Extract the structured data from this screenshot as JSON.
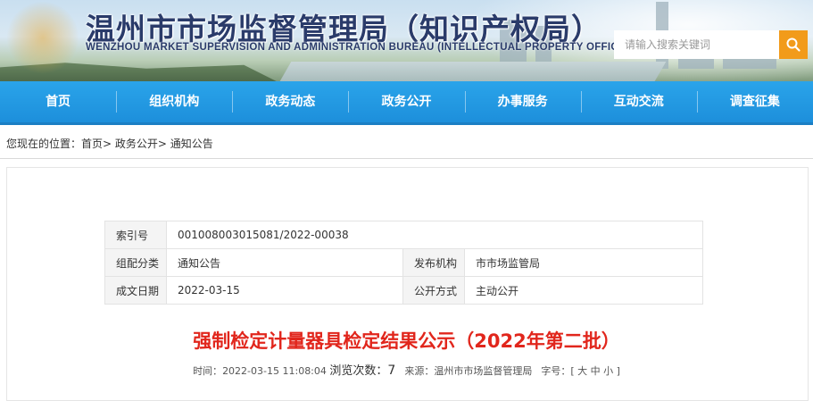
{
  "header": {
    "title_cn": "温州市市场监督管理局（知识产权局）",
    "title_en": "WENZHOU MARKET SUPERVISION AND ADMINISTRATION BUREAU (INTELLECTUAL PROPERTY OFFICE)",
    "search_placeholder": "请输入搜索关键词",
    "search_icon": "search-icon"
  },
  "nav": {
    "items": [
      "首页",
      "组织机构",
      "政务动态",
      "政务公开",
      "办事服务",
      "互动交流",
      "调查征集"
    ]
  },
  "breadcrumb": {
    "prefix": "您现在的位置：",
    "items": [
      "首页",
      "政务公开",
      "通知公告"
    ],
    "separator": "> "
  },
  "meta": {
    "index_label": "索引号",
    "index_value": "001008003015081/2022-00038",
    "category_label": "组配分类",
    "category_value": "通知公告",
    "publisher_label": "发布机构",
    "publisher_value": "市市场监管局",
    "date_label": "成文日期",
    "date_value": "2022-03-15",
    "method_label": "公开方式",
    "method_value": "主动公开"
  },
  "article": {
    "title": "强制检定计量器具检定结果公示（2022年第二批）",
    "time_label": "时间：",
    "time_value": "2022-03-15 11:08:04",
    "views_label": "浏览次数：",
    "views_value": "7",
    "source_label": "来源：",
    "source_value": "温州市市场监督管理局",
    "font_label": "字号：",
    "font_sizes": [
      "大",
      "中",
      "小"
    ]
  },
  "colors": {
    "nav_blue": "#1d8fdb",
    "search_orange": "#f29b1a",
    "title_red": "#e1261c",
    "header_navy": "#2a3b6a"
  }
}
